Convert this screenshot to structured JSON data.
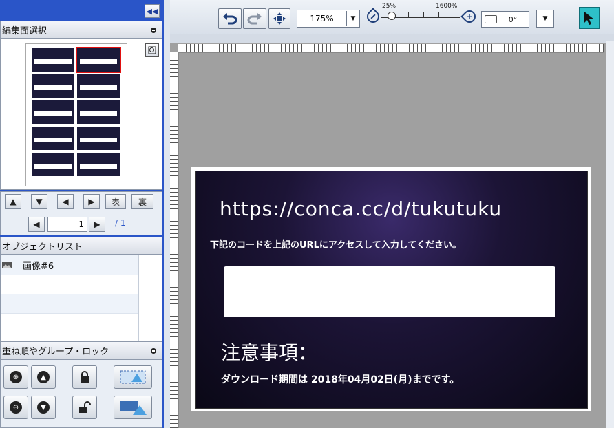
{
  "left_panel": {
    "section_title": "編集面選択",
    "face_front": "表",
    "face_back": "裏",
    "page_current": "1",
    "page_total": "/ 1",
    "object_list_title": "オブジェクトリスト",
    "object_item": "画像#6",
    "order_title": "重ね順やグループ・ロック"
  },
  "toolbar": {
    "zoom_value": "175%",
    "zoom_min": "25%",
    "zoom_max": "1600%",
    "rotation": "0°"
  },
  "card": {
    "url": "https://conca.cc/d/tukutuku",
    "instruction": "下記のコードを上記のURLにアクセスして入力してください。",
    "notice_title": "注意事項：",
    "notice_body": "ダウンロード期間は 2018年04月02日(月)までです。"
  }
}
